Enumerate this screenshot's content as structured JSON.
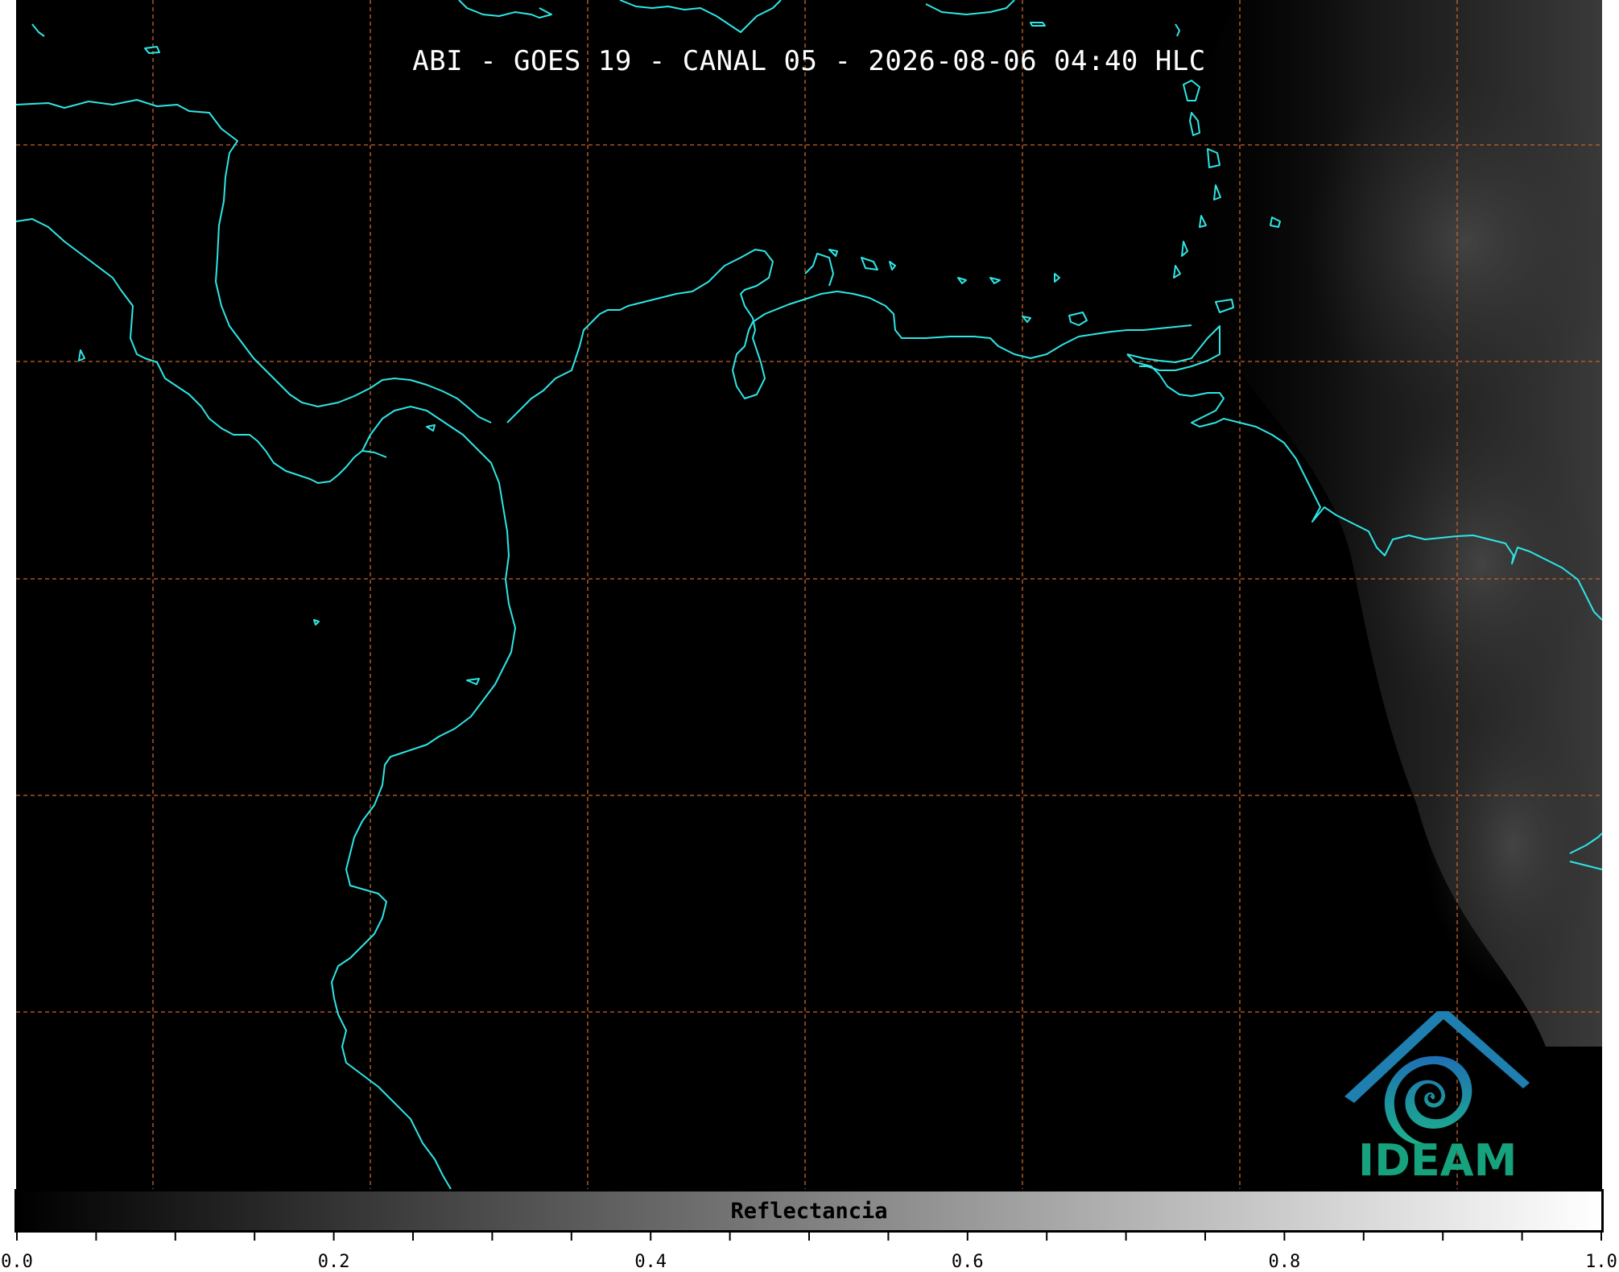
{
  "map": {
    "title": "ABI - GOES 19 - CANAL 05 - 2026-08-06 04:40 HLC",
    "coastline_color": "#2ee6e6",
    "grid_color": "#c8642a",
    "background_color": "#000000"
  },
  "logo": {
    "text": "IDEAM",
    "icon": "ideam-logo-icon"
  },
  "colorbar": {
    "label": "Reflectancia",
    "min": 0.0,
    "max": 1.0,
    "tick_labels": [
      "0.0",
      "0.2",
      "0.4",
      "0.6",
      "0.8",
      "1.0"
    ],
    "colormap": "grayscale"
  }
}
